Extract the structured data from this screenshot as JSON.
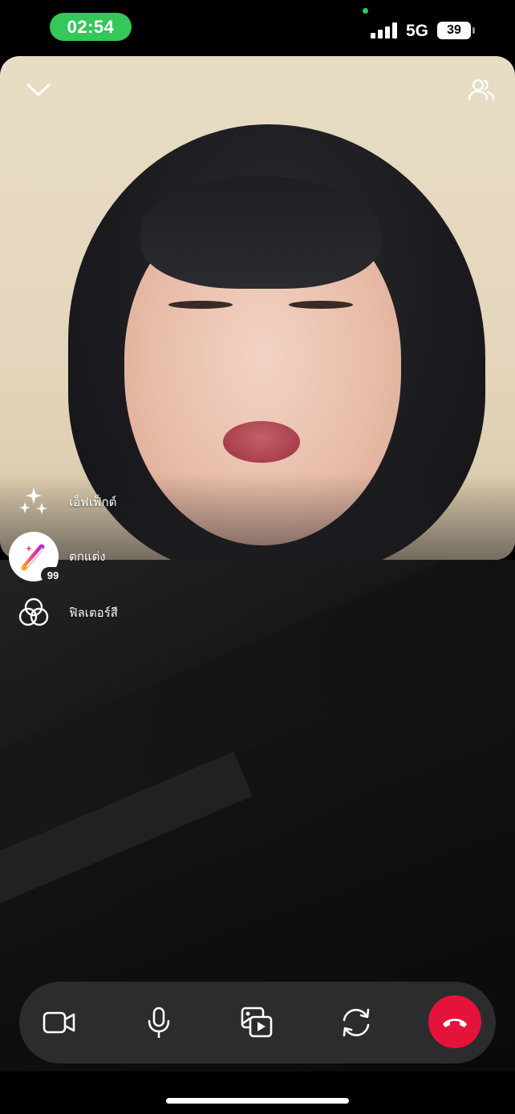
{
  "status_bar": {
    "time": "02:54",
    "network": "5G",
    "battery": "39"
  },
  "call": {
    "remote_video_alt": "",
    "icons": {
      "minimize": "chevron-down-icon",
      "participants": "participants-icon"
    }
  },
  "effects_menu": {
    "items": [
      {
        "label": "เอ็ฟเฟ็กต์",
        "icon": "sparkles-icon"
      },
      {
        "label": "ตกแต่ง",
        "icon": "beauty-wand-icon",
        "badge": "99"
      },
      {
        "label": "ฟิลเตอร์สี",
        "icon": "color-filter-icon"
      }
    ]
  },
  "controls": {
    "items": [
      {
        "name": "camera-toggle",
        "icon": "video-camera-icon"
      },
      {
        "name": "microphone-toggle",
        "icon": "microphone-icon"
      },
      {
        "name": "share-media",
        "icon": "media-share-icon"
      },
      {
        "name": "switch-camera",
        "icon": "camera-switch-icon"
      },
      {
        "name": "end-call",
        "icon": "hang-up-icon"
      }
    ],
    "colors": {
      "bar": "#2c2c2e",
      "end_call": "#e5133a",
      "status_pill": "#34c759"
    }
  }
}
